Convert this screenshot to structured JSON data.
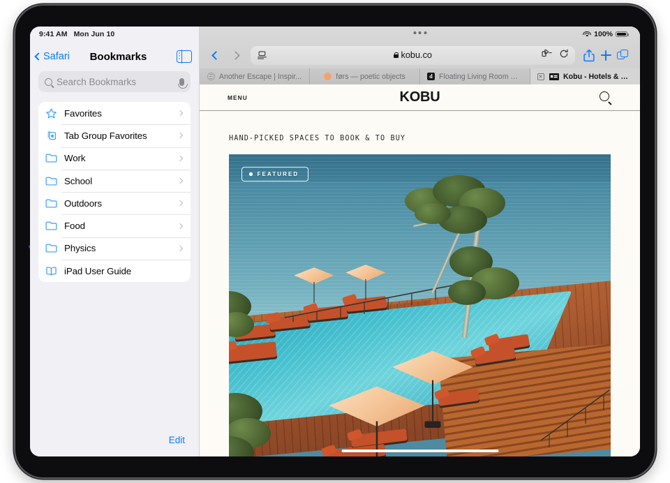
{
  "statusbar": {
    "time": "9:41 AM",
    "date": "Mon Jun 10"
  },
  "browser_status": {
    "battery_percent": "100%",
    "wifi_icon": "wifi-icon",
    "battery_icon": "battery-icon"
  },
  "sidebar": {
    "back_label": "Safari",
    "title": "Bookmarks",
    "toggle_icon": "sidebar-toggle-icon",
    "search": {
      "placeholder": "Search Bookmarks",
      "icon": "search-icon",
      "mic_icon": "microphone-icon"
    },
    "edit_label": "Edit",
    "items": [
      {
        "label": "Favorites",
        "icon": "star-icon",
        "chevron": true
      },
      {
        "label": "Tab Group Favorites",
        "icon": "tab-group-star-icon",
        "chevron": true
      },
      {
        "label": "Work",
        "icon": "folder-icon",
        "chevron": true
      },
      {
        "label": "School",
        "icon": "folder-icon",
        "chevron": true
      },
      {
        "label": "Outdoors",
        "icon": "folder-icon",
        "chevron": true
      },
      {
        "label": "Food",
        "icon": "folder-icon",
        "chevron": true
      },
      {
        "label": "Physics",
        "icon": "folder-icon",
        "chevron": true
      },
      {
        "label": "iPad User Guide",
        "icon": "book-icon",
        "chevron": false
      }
    ]
  },
  "toolbar": {
    "back_icon": "chevron-left-icon",
    "forward_icon": "chevron-right-icon",
    "page_settings_icon": "page-settings-icon",
    "url": "kobu.co",
    "lock_icon": "lock-icon",
    "extensions_icon": "extensions-puzzle-icon",
    "reload_icon": "reload-icon",
    "share_icon": "share-icon",
    "new_tab_icon": "plus-icon",
    "tab_overview_icon": "tabs-icon"
  },
  "tabs": [
    {
      "label": "Another Escape | Inspir...",
      "favicon": "globe-icon",
      "active": false,
      "closable": false
    },
    {
      "label": "førs — poetic objects",
      "favicon": "orange-dot-icon",
      "active": false,
      "closable": false
    },
    {
      "label": "Floating Living Room Se...",
      "favicon": "dezeen-d-icon",
      "active": false,
      "closable": false
    },
    {
      "label": "Kobu - Hotels & Propert...",
      "favicon": "kobu-icon",
      "active": true,
      "closable": true
    }
  ],
  "page": {
    "menu_label": "MENU",
    "brand": "KOBU",
    "search_icon": "search-icon",
    "tagline": "HAND-PICKED SPACES TO BOOK & TO BUY",
    "featured_badge": "FEATURED",
    "hero_alt": "Clifftop infinity pool with orange loungers, umbrellas and a tree overlooking the ocean"
  },
  "colors": {
    "accent_blue": "#0a7bff",
    "sidebar_bg": "#f0f0f5",
    "page_bg": "#fdfbf6",
    "chrome_bg": "#d2d2d2",
    "sea": "#4c8ca4",
    "pool": "#45c0cf",
    "deck": "#a8562a",
    "umbrella": "#f5c79a"
  }
}
